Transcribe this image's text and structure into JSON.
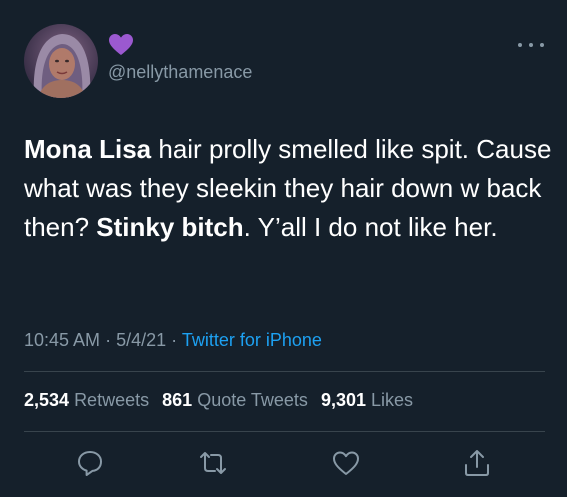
{
  "tweet": {
    "display_name_emoji": "purple-heart",
    "handle": "@nellythamenace",
    "text_segments": [
      {
        "text": "Mona Lisa",
        "bold": true
      },
      {
        "text": " hair prolly smelled like spit. Cause what was they sleekin they hair down w back then? ",
        "bold": false
      },
      {
        "text": "Stinky bitch",
        "bold": true
      },
      {
        "text": ". Y’all I do not like her.",
        "bold": false
      }
    ],
    "time": "10:45 AM",
    "date": "5/4/21",
    "source": "Twitter for iPhone",
    "retweets_count": "2,534",
    "retweets_label": "Retweets",
    "quote_count": "861",
    "quote_label": "Quote Tweets",
    "likes_count": "9,301",
    "likes_label": "Likes"
  },
  "colors": {
    "background": "#15202b",
    "secondary_text": "#8899a6",
    "link": "#1da1f2",
    "divider": "#38444d",
    "heart": "#9b59d0"
  },
  "icons": [
    "more-icon",
    "reply-icon",
    "retweet-icon",
    "like-icon",
    "share-icon"
  ]
}
